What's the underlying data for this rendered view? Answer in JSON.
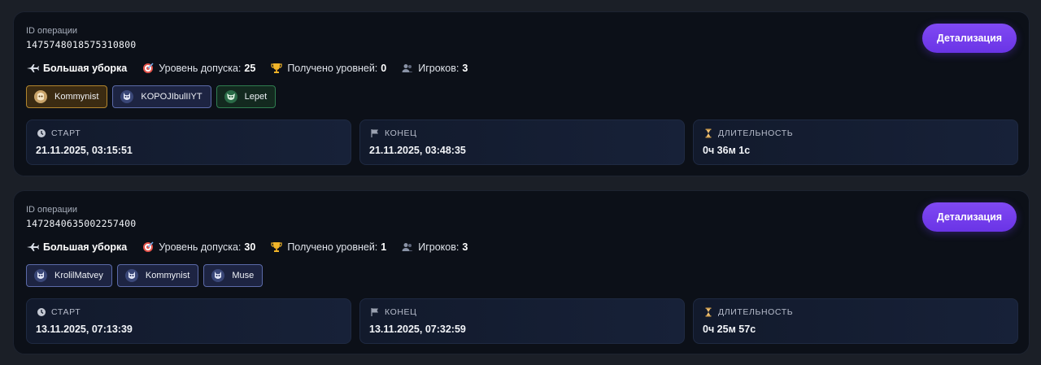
{
  "operations": [
    {
      "id_label": "ID операции",
      "id_value": "1475748018575310800",
      "detail_button": "Детализация",
      "mission": "Большая уборка",
      "access_level_label": "Уровень допуска:",
      "access_level_value": "25",
      "levels_label": "Получено уровней:",
      "levels_value": "0",
      "players_label": "Игроков:",
      "players_value": "3",
      "players": [
        {
          "name": "Kommynist",
          "style": "gold"
        },
        {
          "name": "KOPOJIbulIIYT",
          "style": "blue"
        },
        {
          "name": "Lepet",
          "style": "green"
        }
      ],
      "start_label": "СТАРТ",
      "start_value": "21.11.2025, 03:15:51",
      "end_label": "КОНЕЦ",
      "end_value": "21.11.2025, 03:48:35",
      "duration_label": "ДЛИТЕЛЬНОСТЬ",
      "duration_value": "0ч 36м 1с"
    },
    {
      "id_label": "ID операции",
      "id_value": "1472840635002257400",
      "detail_button": "Детализация",
      "mission": "Большая уборка",
      "access_level_label": "Уровень допуска:",
      "access_level_value": "30",
      "levels_label": "Получено уровней:",
      "levels_value": "1",
      "players_label": "Игроков:",
      "players_value": "3",
      "players": [
        {
          "name": "KrolilMatvey",
          "style": "blue"
        },
        {
          "name": "Kommynist",
          "style": "blue"
        },
        {
          "name": "Muse",
          "style": "blue"
        }
      ],
      "start_label": "СТАРТ",
      "start_value": "13.11.2025, 07:13:39",
      "end_label": "КОНЕЦ",
      "end_value": "13.11.2025, 07:32:59",
      "duration_label": "ДЛИТЕЛЬНОСТЬ",
      "duration_value": "0ч 25м 57с"
    }
  ],
  "icons": {
    "mission": "plane-icon",
    "access": "target-icon",
    "levels": "trophy-icon",
    "players": "users-icon",
    "start": "clock-icon",
    "end": "flag-icon",
    "duration": "hourglass-icon"
  },
  "colors": {
    "accent": "#7440ee",
    "card_bg": "#0c1018",
    "page_bg": "#1b1f27",
    "player_gold": "#b2852e",
    "player_green": "#2f7d50",
    "player_blue": "#5b6aa8"
  }
}
